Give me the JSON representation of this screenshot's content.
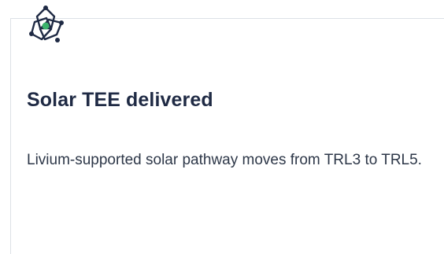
{
  "card": {
    "icon": "atom-orbit-icon",
    "title": "Solar TEE delivered",
    "description": "Livium-supported solar pathway moves from TRL3 to TRL5."
  },
  "colors": {
    "icon_stroke": "#1f2a44",
    "icon_dot": "#3bb36b",
    "title": "#1f2a44",
    "text": "#2d3748",
    "border": "#dde1e6"
  }
}
